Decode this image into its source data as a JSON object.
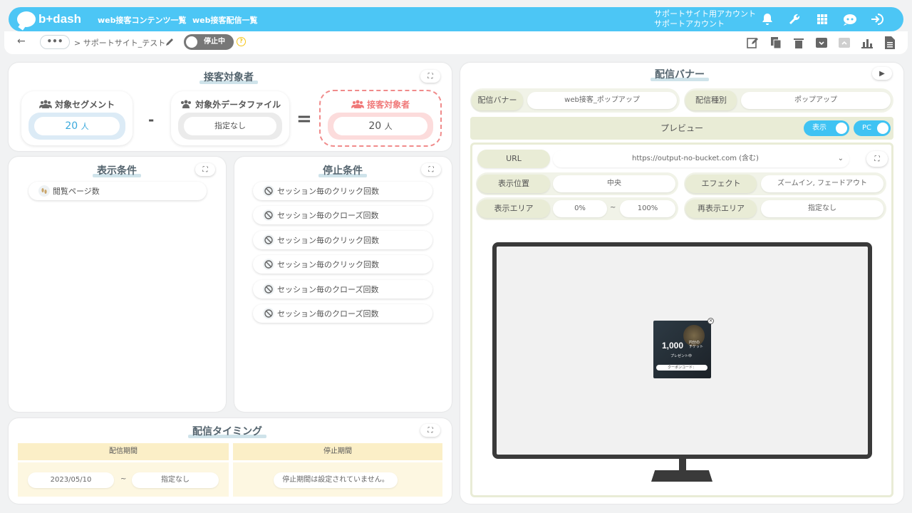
{
  "header": {
    "logo_text": "b+dash",
    "nav": [
      "web接客コンテンツ一覧",
      "web接客配信一覧"
    ],
    "account_line1": "サポートサイト用アカウント",
    "account_line2": "サポートアカウント",
    "icons": [
      "bell-icon",
      "wrench-icon",
      "grid-icon",
      "chat-bot-icon",
      "logout-icon"
    ],
    "accent": "#4cc6f5"
  },
  "subbar": {
    "dots": "•••",
    "breadcrumb": "> サポートサイト_テスト",
    "status_toggle": "停止中",
    "help": "?",
    "actions": [
      "edit-icon",
      "copy-icon",
      "delete-icon",
      "archive-icon",
      "unarchive-icon",
      "report-icon",
      "document-icon"
    ]
  },
  "target": {
    "title": "接客対象者",
    "segment_title": "対象セグメント",
    "segment_value": "20",
    "segment_unit": "人",
    "exclude_title": "対象外データファイル",
    "exclude_value": "指定なし",
    "minus": "-",
    "equals": "=",
    "result_title": "接客対象者",
    "result_value": "20",
    "result_unit": "人"
  },
  "display_conditions": {
    "title": "表示条件",
    "items": [
      "閲覧ページ数"
    ]
  },
  "stop_conditions": {
    "title": "停止条件",
    "items": [
      "セッション毎のクリック回数",
      "セッション毎のクローズ回数",
      "セッション毎のクリック回数",
      "セッション毎のクリック回数",
      "セッション毎のクローズ回数",
      "セッション毎のクローズ回数"
    ]
  },
  "timing": {
    "title": "配信タイミング",
    "period_header": "配信期間",
    "stop_header": "停止期間",
    "start_date": "2023/05/10",
    "tilde": "~",
    "end_date": "指定なし",
    "stop_text": "停止期間は設定されていません。"
  },
  "banner": {
    "title": "配信バナー",
    "banner_label": "配信バナー",
    "banner_value": "web接客_ポップアップ",
    "type_label": "配信種別",
    "type_value": "ポップアップ",
    "preview_label": "プレビュー",
    "show_toggle": "表示",
    "pc_toggle": "PC",
    "url_label": "URL",
    "url_value": "https://output-no-bucket.com (含む)",
    "position_label": "表示位置",
    "position_value": "中央",
    "effect_label": "エフェクト",
    "effect_value": "ズームイン, フェードアウト",
    "area_label": "表示エリア",
    "area_from": "0%",
    "area_tilde": "~",
    "area_to": "100%",
    "redisplay_label": "再表示エリア",
    "redisplay_value": "指定なし",
    "popup_amount": "1,000",
    "popup_small": "円分の",
    "popup_small2": "チケット",
    "popup_present": "プレゼント中",
    "popup_coupon": "クーポンコード："
  }
}
